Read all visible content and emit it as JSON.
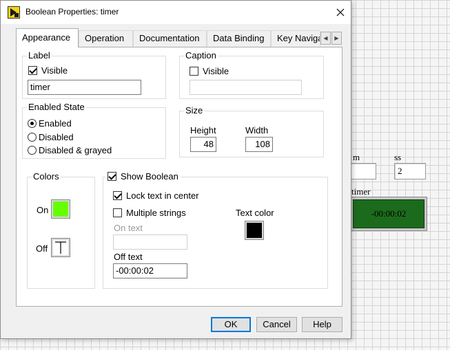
{
  "window": {
    "title": "Boolean Properties: timer"
  },
  "tabs": [
    {
      "label": "Appearance",
      "active": true
    },
    {
      "label": "Operation"
    },
    {
      "label": "Documentation"
    },
    {
      "label": "Data Binding"
    },
    {
      "label": "Key Naviga"
    }
  ],
  "label_group": {
    "title": "Label",
    "visible_label": "Visible",
    "visible_checked": true,
    "value": "timer"
  },
  "caption_group": {
    "title": "Caption",
    "visible_label": "Visible",
    "visible_checked": false,
    "value": ""
  },
  "enabled_state": {
    "title": "Enabled State",
    "options": [
      "Enabled",
      "Disabled",
      "Disabled & grayed"
    ],
    "selected": "Enabled"
  },
  "size": {
    "title": "Size",
    "height_label": "Height",
    "height_value": "48",
    "width_label": "Width",
    "width_value": "108"
  },
  "colors": {
    "title": "Colors",
    "on_label": "On",
    "on_color": "#66ff00",
    "off_label": "Off",
    "off_color": "#ffffff"
  },
  "show_boolean": {
    "title": "Show Boolean",
    "checked": true,
    "lock_text_label": "Lock text in center",
    "lock_text_checked": true,
    "multiple_strings_label": "Multiple strings",
    "multiple_strings_checked": false,
    "on_text_label": "On text",
    "on_text_value": "",
    "off_text_label": "Off text",
    "off_text_value": "-00:00:02",
    "text_color_label": "Text color",
    "text_color": "#000000"
  },
  "buttons": {
    "ok": "OK",
    "cancel": "Cancel",
    "help": "Help"
  },
  "front_panel": {
    "label_m": "m",
    "label_ss": "ss",
    "ss_value": "2",
    "timer_label": "timer",
    "timer_value": "-00:00:02",
    "led_color": "#1c6b1c"
  }
}
